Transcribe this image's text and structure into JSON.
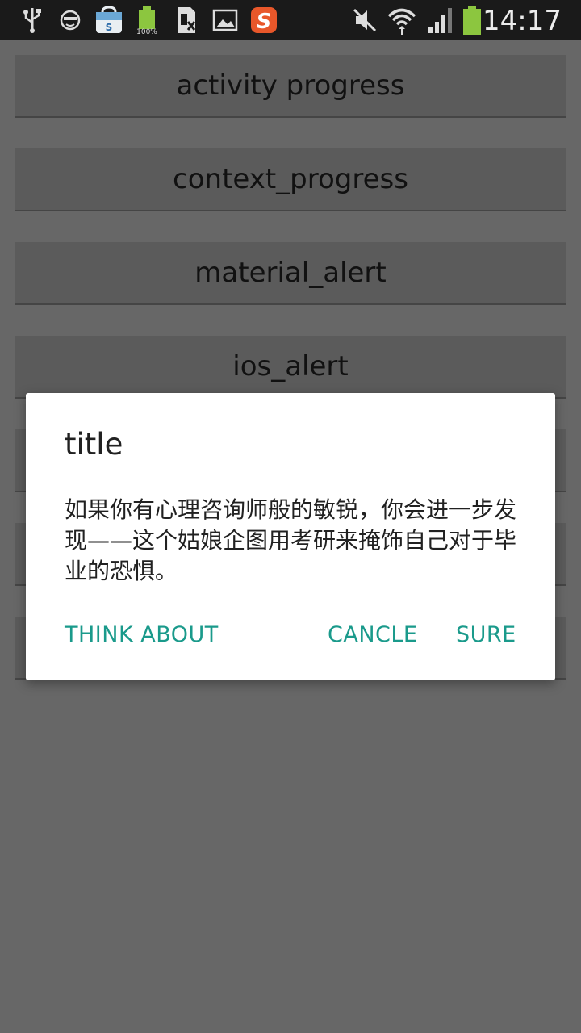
{
  "status_bar": {
    "time": "14:17",
    "battery_level_label": "100%",
    "icons": [
      "usb-icon",
      "face-icon",
      "store-icon",
      "battery-small-icon",
      "sim-icon",
      "image-icon",
      "sogou-icon",
      "mute-icon",
      "wifi-icon",
      "signal-icon",
      "battery-icon"
    ]
  },
  "buttons": [
    {
      "label": "activity progress"
    },
    {
      "label": "context_progress"
    },
    {
      "label": "material_alert"
    },
    {
      "label": "ios_alert"
    },
    {
      "label": ""
    },
    {
      "label": ""
    },
    {
      "label": ""
    }
  ],
  "dialog": {
    "title": "title",
    "message": "如果你有心理咨询师般的敏锐，你会进一步发现——这个姑娘企图用考研来掩饰自己对于毕业的恐惧。",
    "neutral_label": "THINK ABOUT",
    "negative_label": "CANCLE",
    "positive_label": "SURE",
    "accent_color": "#1a9a8b"
  }
}
